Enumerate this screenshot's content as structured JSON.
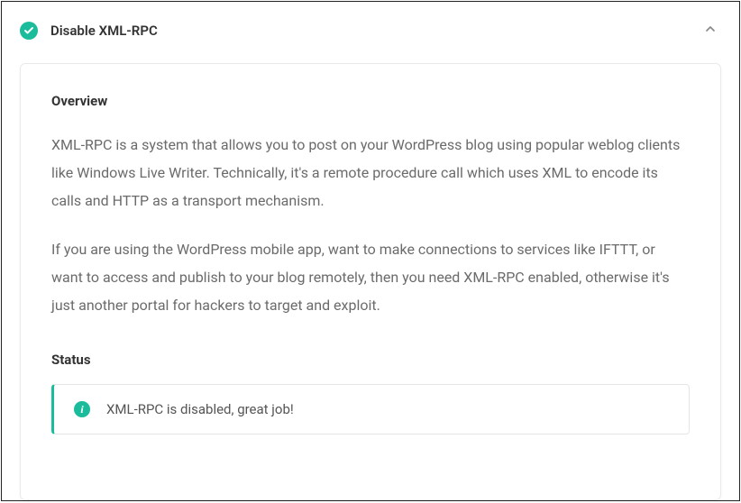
{
  "header": {
    "title": "Disable XML-RPC"
  },
  "content": {
    "overview_heading": "Overview",
    "paragraph1": "XML-RPC is a system that allows you to post on your WordPress blog using popular weblog clients like Windows Live Writer. Technically, it's a remote procedure call which uses XML to encode its calls and HTTP as a transport mechanism.",
    "paragraph2": "If you are using the WordPress mobile app, want to make connections to services like IFTTT, or want to access and publish to your blog remotely, then you need XML-RPC enabled, otherwise it's just another portal for hackers to target and exploit.",
    "status_heading": "Status",
    "status_message": "XML-RPC is disabled, great job!"
  },
  "colors": {
    "accent": "#1abc9c"
  }
}
